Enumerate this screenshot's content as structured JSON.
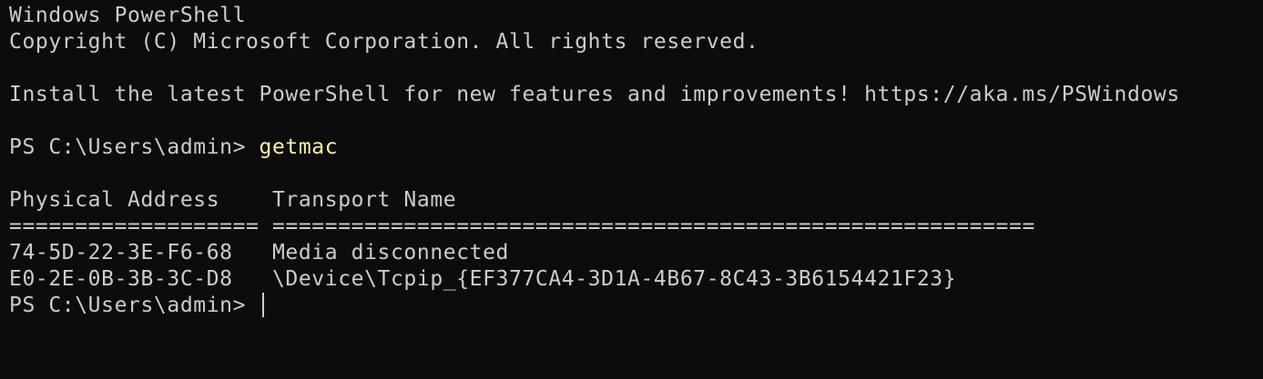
{
  "terminal": {
    "banner_title": "Windows PowerShell",
    "copyright": "Copyright (C) Microsoft Corporation. All rights reserved.",
    "install_hint": "Install the latest PowerShell for new features and improvements! https://aka.ms/PSWindows",
    "prompt": "PS C:\\Users\\admin> ",
    "command": "getmac",
    "output": {
      "header_physical": "Physical Address",
      "header_transport": "Transport Name",
      "separator_physical": "===================",
      "separator_transport": "==========================================================",
      "rows": [
        {
          "address": "74-5D-22-3E-F6-68",
          "transport": "Media disconnected"
        },
        {
          "address": "E0-2E-0B-3B-3C-D8",
          "transport": "\\Device\\Tcpip_{EF377CA4-3D1A-4B67-8C43-3B6154421F23}"
        }
      ]
    },
    "final_prompt": "PS C:\\Users\\admin> ",
    "colors": {
      "background": "#0c0c0c",
      "text": "#cccccc",
      "command": "#f9f1a5"
    }
  }
}
